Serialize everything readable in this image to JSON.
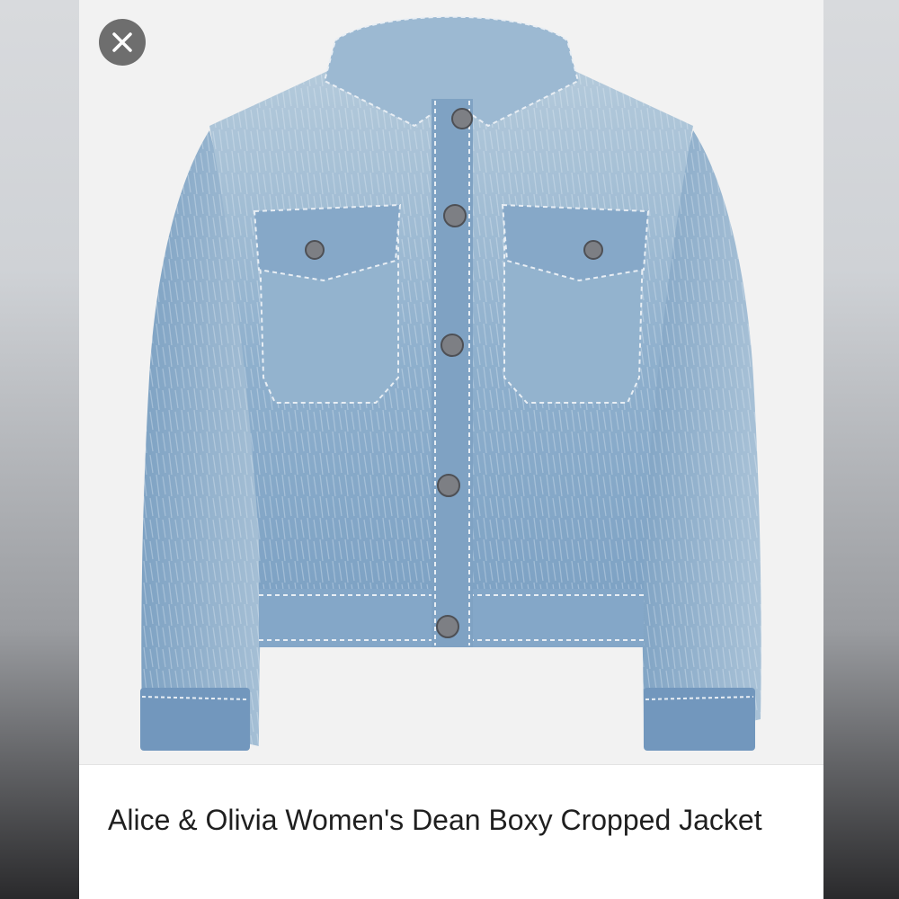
{
  "product": {
    "title": "Alice & Olivia Women's Dean Boxy Cropped Jacket",
    "image_subject": "light-wash denim jacket"
  },
  "close_button": {
    "icon": "close-icon"
  },
  "colors": {
    "denim_light": "#a9c3d8",
    "denim_mid": "#7fa2c2",
    "denim_dark": "#5b7ea3",
    "button_metal": "#7d7f84",
    "close_bg": "#6e6e6e"
  }
}
